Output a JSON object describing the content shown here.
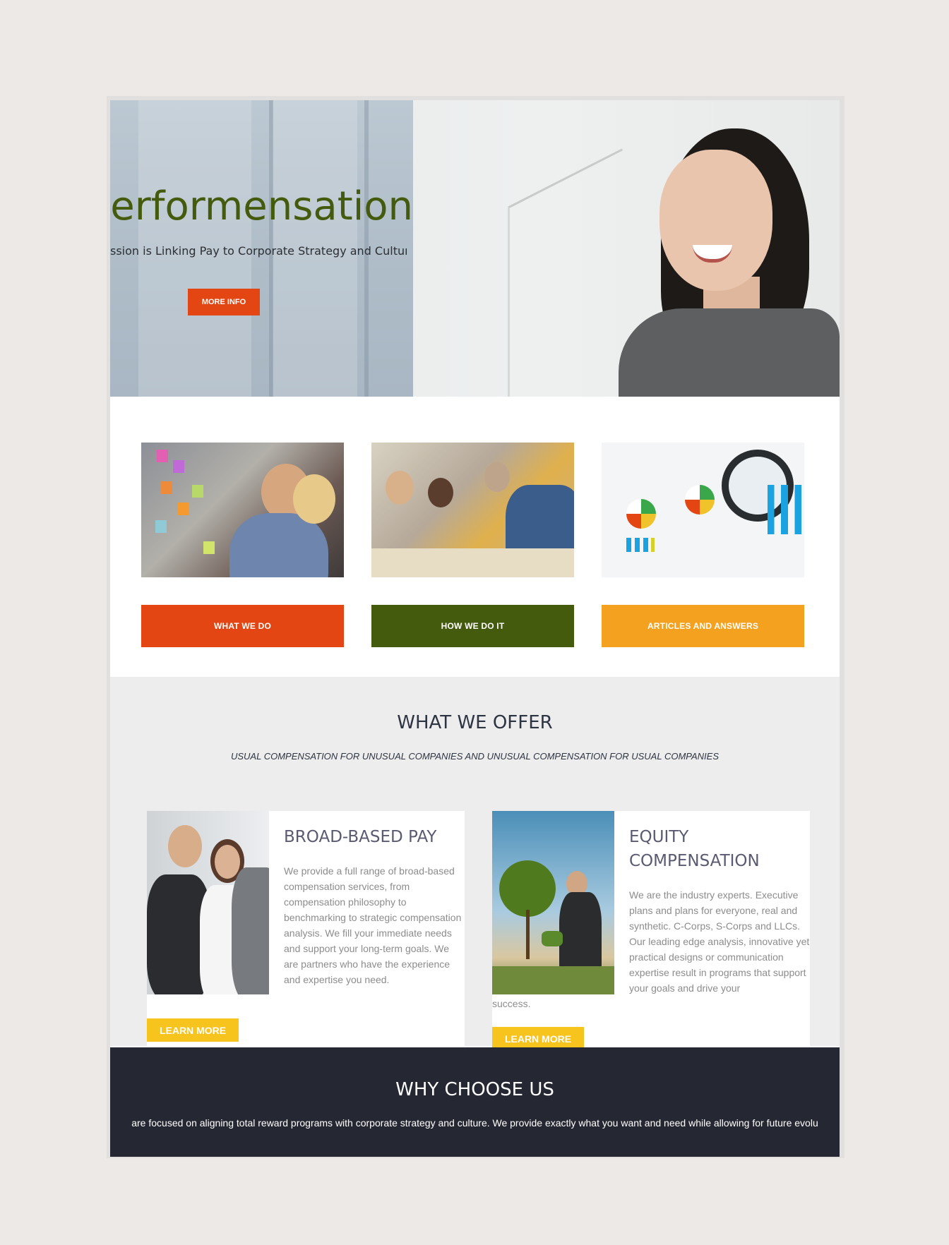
{
  "hero": {
    "title": "erformensation",
    "subtitle": "ssion is Linking Pay to Corporate Strategy and Culture",
    "button_label": "MORE INFO"
  },
  "features": [
    {
      "label": "WHAT WE DO",
      "color": "#e44613"
    },
    {
      "label": "HOW WE DO IT",
      "color": "#445b0e"
    },
    {
      "label": "ARTICLES AND ANSWERS",
      "color": "#f4a11f"
    }
  ],
  "offer": {
    "title": "WHAT WE OFFER",
    "subtitle": "USUAL COMPENSATION FOR UNUSUAL COMPANIES AND UNUSUAL COMPENSATION FOR USUAL COMPANIES",
    "cards": [
      {
        "title": "BROAD-BASED PAY",
        "text": "We provide a full range of broad-based compensation services, from compensation philosophy to benchmarking to strategic compensation analysis. We fill your immediate needs and support your long-term goals. We are partners who have the experience and expertise you need.",
        "button_label": "LEARN MORE"
      },
      {
        "title": "EQUITY COMPENSATION",
        "text": "We are the industry experts. Executive plans and plans for everyone, real and synthetic. C-Corps, S-Corps and LLCs. Our leading edge analysis, innovative yet practical designs or communication expertise result in programs that support your goals and drive your",
        "text_tail": "success.",
        "button_label": "LEARN MORE"
      }
    ]
  },
  "why": {
    "title": "WHY CHOOSE US",
    "text": "are focused on aligning total reward programs with corporate strategy and culture. We provide exactly what you want and need while allowing for future evolu"
  },
  "colors": {
    "accent_orange": "#e44613",
    "accent_green": "#445b0e",
    "accent_amber": "#f4a11f",
    "learn_yellow": "#f7c31d",
    "dark_band": "#252832"
  }
}
